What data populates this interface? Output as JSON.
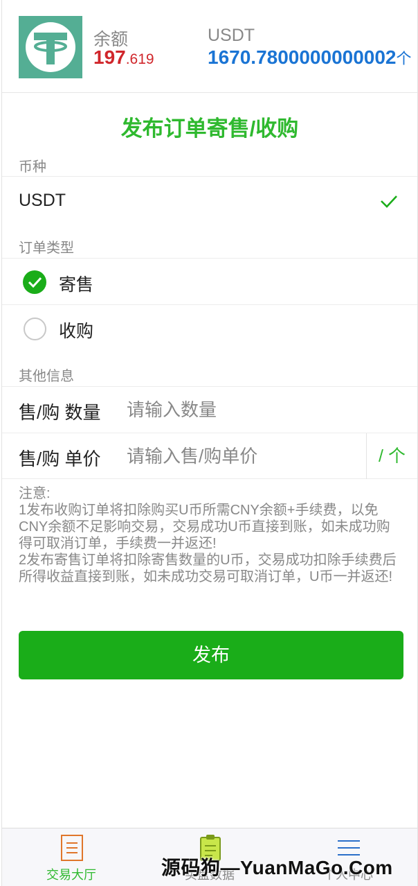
{
  "header": {
    "balance_label": "余额",
    "balance_int": "197",
    "balance_dec": ".619",
    "usdt_label": "USDT",
    "usdt_amount": "1670.7800000000002",
    "usdt_unit": "个"
  },
  "page_title": "发布订单寄售/收购",
  "currency": {
    "section_label": "币种",
    "selected": "USDT"
  },
  "order_type": {
    "section_label": "订单类型",
    "options": [
      {
        "label": "寄售",
        "checked": true
      },
      {
        "label": "收购",
        "checked": false
      }
    ]
  },
  "other_info": {
    "section_label": "其他信息",
    "quantity_label": "售/购 数量",
    "quantity_placeholder": "请输入数量",
    "price_label": "售/购 单价",
    "price_placeholder": "请输入售/购单价",
    "price_unit": "/ 个"
  },
  "notice": {
    "title": "注意:",
    "line1": "1发布收购订单将扣除购买U币所需CNY余额+手续费，以免CNY余额不足影响交易，交易成功U币直接到账，如未成功购得可取消订单，手续费一并返还!",
    "line2": "2发布寄售订单将扣除寄售数量的U币，交易成功扣除手续费后所得收益直接到账，如未成功交易可取消订单，U币一并返还!"
  },
  "submit_label": "发布",
  "tabbar": {
    "tabs": [
      {
        "label": "交易大厅",
        "icon": "document-icon",
        "active": true
      },
      {
        "label": "买盘数据",
        "icon": "clipboard-icon",
        "active": false
      },
      {
        "label": "个人中心",
        "icon": "menu-icon",
        "active": false
      }
    ]
  },
  "watermark": "源码狗—YuanMaGo.Com",
  "colors": {
    "accent_green": "#1aad19",
    "title_green": "#2fb92f",
    "balance_red": "#d0262b",
    "usdt_blue": "#1a74d4",
    "logo_teal": "#54ae94"
  }
}
